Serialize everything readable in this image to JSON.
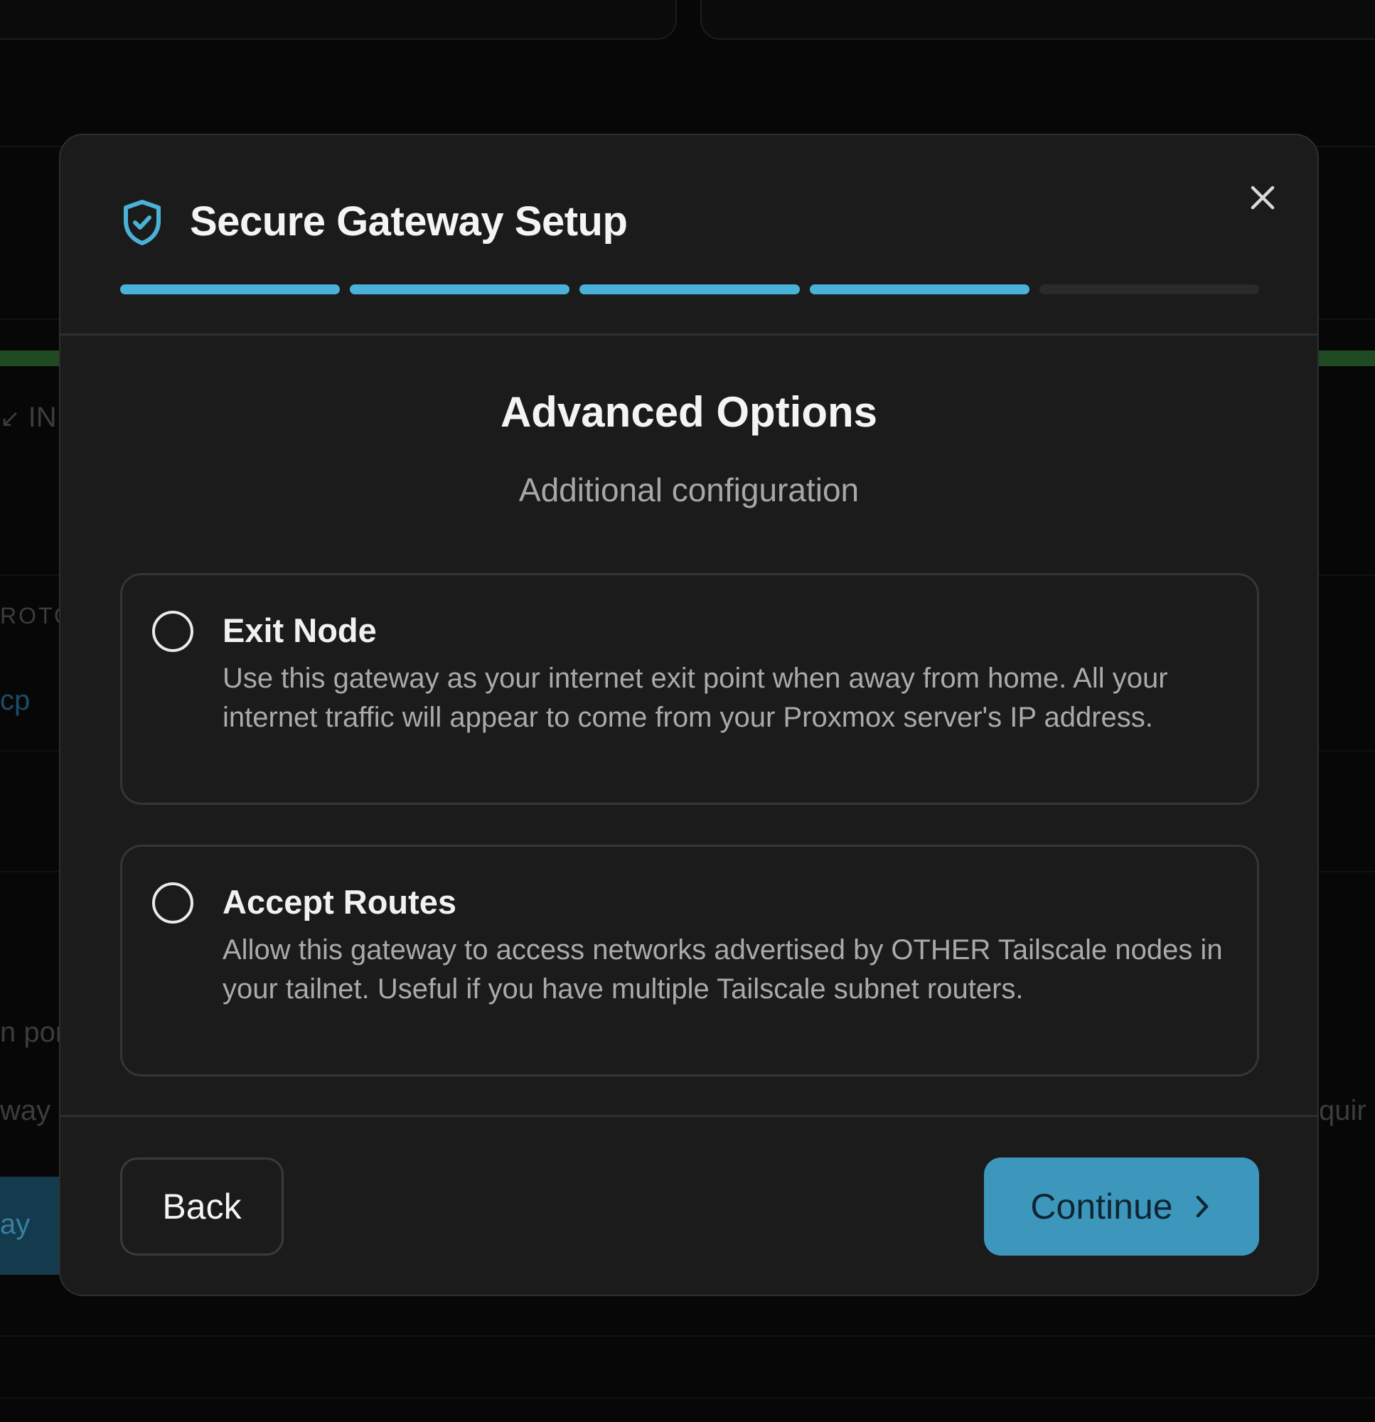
{
  "background": {
    "fragments": [
      "IN",
      "ROTO",
      "cp",
      "n por",
      "way",
      "ay",
      "quir"
    ]
  },
  "modal": {
    "title": "Secure Gateway Setup",
    "progress": {
      "total_steps": 5,
      "completed_steps": 4
    },
    "step_title": "Advanced Options",
    "step_subtitle": "Additional configuration",
    "options": [
      {
        "title": "Exit Node",
        "description": "Use this gateway as your internet exit point when away from home. All your internet traffic will appear to come from your Proxmox server's IP address.",
        "checked": false
      },
      {
        "title": "Accept Routes",
        "description": "Allow this gateway to access networks advertised by OTHER Tailscale nodes in your tailnet. Useful if you have multiple Tailscale subnet routers.",
        "checked": false
      }
    ],
    "back_label": "Back",
    "continue_label": "Continue"
  },
  "colors": {
    "accent": "#4ab1d8",
    "button_primary": "#3d97bd",
    "modal_bg": "#1b1b1b"
  },
  "icons": {
    "header": "shield-check-icon",
    "close": "close-icon",
    "continue": "chevron-right-icon"
  }
}
